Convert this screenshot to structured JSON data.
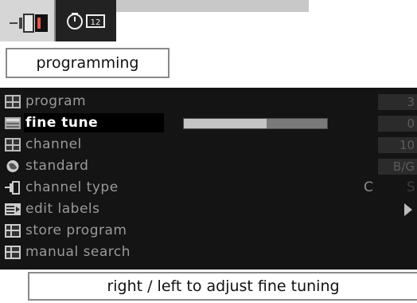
{
  "tabs": [
    {
      "icon": "tv-programming-icon",
      "active": true
    },
    {
      "icon": "timer-clock-icon",
      "active": false,
      "badge": "12"
    }
  ],
  "title": "programming",
  "menu": {
    "items": [
      {
        "icon": "program-grid-icon",
        "label": "program",
        "value": "3"
      },
      {
        "icon": "fine-tune-icon",
        "label": "fine tune",
        "value": "0",
        "selected": true,
        "bar_fraction": 0.58
      },
      {
        "icon": "channel-grid-icon",
        "label": "channel",
        "value": "10"
      },
      {
        "icon": "globe-icon",
        "label": "standard",
        "value": "B/G"
      },
      {
        "icon": "plug-icon",
        "label": "channel type",
        "options": [
          "C",
          "S"
        ]
      },
      {
        "icon": "edit-labels-icon",
        "label": "edit labels"
      },
      {
        "icon": "store-program-icon",
        "label": "store program"
      },
      {
        "icon": "manual-search-icon",
        "label": "manual search"
      }
    ]
  },
  "help": {
    "text": "right / left to adjust fine tuning"
  },
  "colors": {
    "panel": "#141414",
    "text": "#9a9a9a",
    "selected_text": "#ffffff"
  }
}
